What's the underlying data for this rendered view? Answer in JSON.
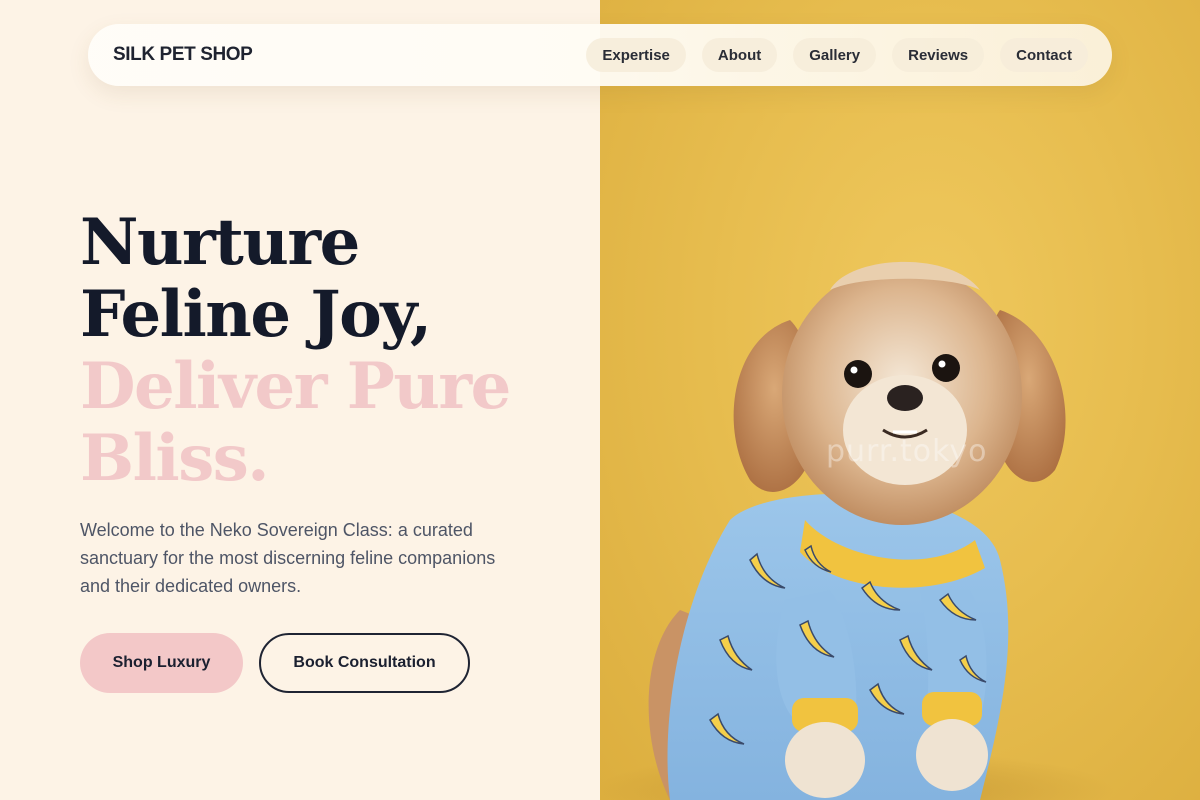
{
  "brand": {
    "name": "SILK PET SHOP"
  },
  "nav": {
    "items": [
      {
        "label": "Expertise"
      },
      {
        "label": "About"
      },
      {
        "label": "Gallery"
      },
      {
        "label": "Reviews"
      },
      {
        "label": "Contact"
      }
    ]
  },
  "hero": {
    "headline_line1": "Nurture",
    "headline_line2": "Feline Joy,",
    "headline_line3": "Deliver Pure",
    "headline_line4": "Bliss.",
    "intro": "Welcome to the Neko Sovereign Class: a curated sanctuary for the most discerning feline companions and their dedicated owners.",
    "primary_cta": "Shop Luxury",
    "secondary_cta": "Book Consultation"
  },
  "photo": {
    "subject": "dog-in-banana-pajamas",
    "watermark": "purr.tokyo"
  },
  "colors": {
    "background": "#fdf3e6",
    "headline_dark": "#141a2a",
    "headline_accent": "#f2c9c9",
    "photo_backdrop": "#e9bf52",
    "primary_button": "#f3c8c8"
  }
}
